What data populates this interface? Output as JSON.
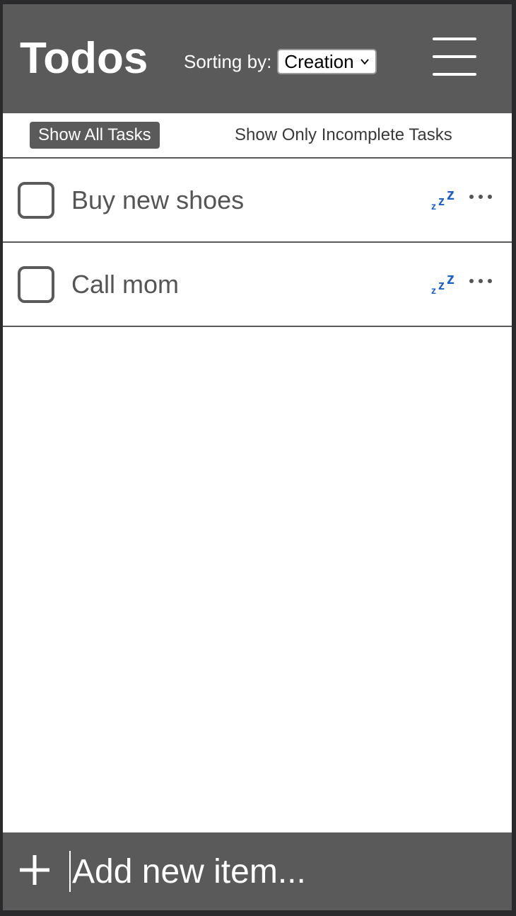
{
  "header": {
    "title": "Todos",
    "sort_label": "Sorting by:",
    "sort_value": "Creation",
    "menu_icon": "hamburger-menu-icon"
  },
  "filters": {
    "all_label": "Show All Tasks",
    "incomplete_label": "Show Only Incomplete Tasks",
    "active": "all"
  },
  "tasks": [
    {
      "label": "Buy new shoes",
      "checked": false,
      "snooze_icon": "zzz-snooze-icon",
      "more_icon": "more-options-icon"
    },
    {
      "label": "Call mom",
      "checked": false,
      "snooze_icon": "zzz-snooze-icon",
      "more_icon": "more-options-icon"
    }
  ],
  "footer": {
    "add_icon": "plus-icon",
    "input_placeholder": "Add new item..."
  },
  "colors": {
    "header_bg": "#5a5a5a",
    "snooze_blue": "#1b5fc9"
  }
}
